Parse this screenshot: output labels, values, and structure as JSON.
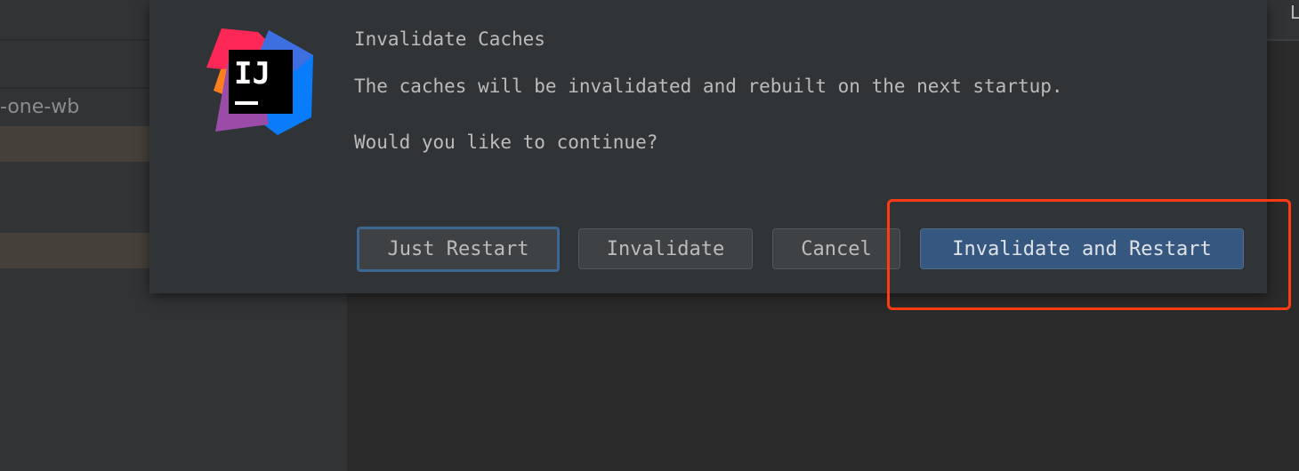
{
  "background": {
    "project_name_fragment": "-one-wb",
    "top_right_fragment": "L"
  },
  "dialog": {
    "title": "Invalidate Caches",
    "message": "The caches will be invalidated and rebuilt on the next startup.",
    "question": "Would you like to continue?",
    "icon": "intellij-idea-logo",
    "buttons": [
      {
        "label": "Just Restart",
        "focused": true
      },
      {
        "label": "Invalidate"
      },
      {
        "label": "Cancel"
      },
      {
        "label": "Invalidate and Restart",
        "default": true
      }
    ]
  },
  "colors": {
    "accent": "#365880",
    "annotation": "#ff3b16"
  }
}
